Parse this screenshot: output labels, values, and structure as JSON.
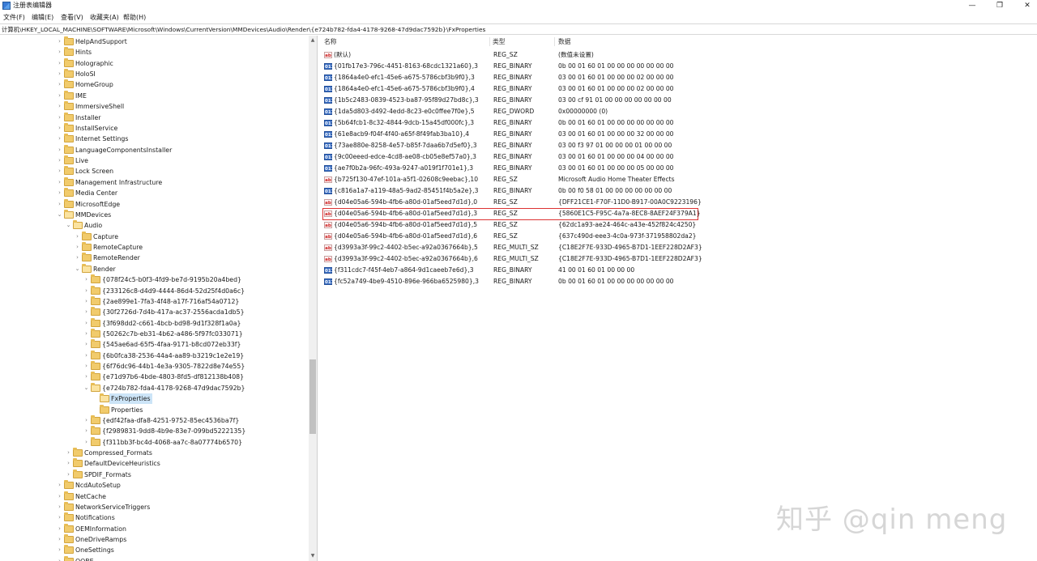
{
  "window": {
    "title": "注册表编辑器",
    "minimize_glyph": "—",
    "maximize_glyph": "❐",
    "close_glyph": "✕"
  },
  "menu": {
    "items": [
      "文件(F)",
      "编辑(E)",
      "查看(V)",
      "收藏夹(A)",
      "帮助(H)"
    ]
  },
  "address": {
    "path": "计算机\\HKEY_LOCAL_MACHINE\\SOFTWARE\\Microsoft\\Windows\\CurrentVersion\\MMDevices\\Audio\\Render\\{e724b782-fda4-4178-9268-47d9dac7592b}\\FxProperties"
  },
  "tree": {
    "items": [
      {
        "label": "HelpAndSupport",
        "level": 0,
        "arrow": "›"
      },
      {
        "label": "Hints",
        "level": 0,
        "arrow": "›"
      },
      {
        "label": "Holographic",
        "level": 0,
        "arrow": "›"
      },
      {
        "label": "HoloSI",
        "level": 0,
        "arrow": "›"
      },
      {
        "label": "HomeGroup",
        "level": 0,
        "arrow": "›"
      },
      {
        "label": "IME",
        "level": 0,
        "arrow": "›"
      },
      {
        "label": "ImmersiveShell",
        "level": 0,
        "arrow": "›"
      },
      {
        "label": "Installer",
        "level": 0,
        "arrow": "›"
      },
      {
        "label": "InstallService",
        "level": 0,
        "arrow": "›"
      },
      {
        "label": "Internet Settings",
        "level": 0,
        "arrow": "›"
      },
      {
        "label": "LanguageComponentsInstaller",
        "level": 0,
        "arrow": "›"
      },
      {
        "label": "Live",
        "level": 0,
        "arrow": "›"
      },
      {
        "label": "Lock Screen",
        "level": 0,
        "arrow": "›"
      },
      {
        "label": "Management Infrastructure",
        "level": 0,
        "arrow": "›"
      },
      {
        "label": "Media Center",
        "level": 0,
        "arrow": "›"
      },
      {
        "label": "MicrosoftEdge",
        "level": 0,
        "arrow": "›"
      },
      {
        "label": "MMDevices",
        "level": 0,
        "arrow": "⌄",
        "open": true
      },
      {
        "label": "Audio",
        "level": 1,
        "arrow": "⌄",
        "open": true
      },
      {
        "label": "Capture",
        "level": 2,
        "arrow": "›"
      },
      {
        "label": "RemoteCapture",
        "level": 2,
        "arrow": "›"
      },
      {
        "label": "RemoteRender",
        "level": 2,
        "arrow": "›"
      },
      {
        "label": "Render",
        "level": 2,
        "arrow": "⌄",
        "open": true
      },
      {
        "label": "{078f24c5-b0f3-4fd9-be7d-9195b20a4bed}",
        "level": 3,
        "arrow": "›"
      },
      {
        "label": "{233126c8-d4d9-4444-86d4-52d25f4d0a6c}",
        "level": 3,
        "arrow": "›"
      },
      {
        "label": "{2ae899e1-7fa3-4f48-a17f-716af54a0712}",
        "level": 3,
        "arrow": "›"
      },
      {
        "label": "{30f2726d-7d4b-417a-ac37-2556acda1db5}",
        "level": 3,
        "arrow": "›"
      },
      {
        "label": "{3f698dd2-c661-4bcb-bd98-9d1f328f1a0a}",
        "level": 3,
        "arrow": "›"
      },
      {
        "label": "{50262c7b-eb31-4b62-a486-5f97fc033071}",
        "level": 3,
        "arrow": "›"
      },
      {
        "label": "{545ae6ad-65f5-4faa-9171-b8cd072eb33f}",
        "level": 3,
        "arrow": "›"
      },
      {
        "label": "{6b0fca38-2536-44a4-aa89-b3219c1e2e19}",
        "level": 3,
        "arrow": "›"
      },
      {
        "label": "{6f76dc96-44b1-4e3a-9305-7822d8e74e55}",
        "level": 3,
        "arrow": "›"
      },
      {
        "label": "{e71d97b6-4bde-4803-8fd5-df812138b408}",
        "level": 3,
        "arrow": "›"
      },
      {
        "label": "{e724b782-fda4-4178-9268-47d9dac7592b}",
        "level": 3,
        "arrow": "⌄",
        "open": true
      },
      {
        "label": "FxProperties",
        "level": 4,
        "arrow": "",
        "selected": true,
        "open": true
      },
      {
        "label": "Properties",
        "level": 4,
        "arrow": ""
      },
      {
        "label": "{edf42faa-dfa8-4251-9752-85ec4536ba7f}",
        "level": 3,
        "arrow": "›"
      },
      {
        "label": "{f2989831-9dd8-4b9e-83e7-099bd5222135}",
        "level": 3,
        "arrow": "›"
      },
      {
        "label": "{f311bb3f-bc4d-4068-aa7c-8a07774b6570}",
        "level": 3,
        "arrow": "›"
      },
      {
        "label": "Compressed_Formats",
        "level": 1,
        "arrow": "›"
      },
      {
        "label": "DefaultDeviceHeuristics",
        "level": 1,
        "arrow": "›"
      },
      {
        "label": "SPDIF_Formats",
        "level": 1,
        "arrow": "›"
      },
      {
        "label": "NcdAutoSetup",
        "level": 0,
        "arrow": "›"
      },
      {
        "label": "NetCache",
        "level": 0,
        "arrow": "›"
      },
      {
        "label": "NetworkServiceTriggers",
        "level": 0,
        "arrow": "›"
      },
      {
        "label": "Notifications",
        "level": 0,
        "arrow": "›"
      },
      {
        "label": "OEMInformation",
        "level": 0,
        "arrow": "›"
      },
      {
        "label": "OneDriveRamps",
        "level": 0,
        "arrow": "›"
      },
      {
        "label": "OneSettings",
        "level": 0,
        "arrow": "›"
      },
      {
        "label": "OOBE",
        "level": 0,
        "arrow": "›"
      }
    ]
  },
  "values": {
    "headers": {
      "name": "名称",
      "type": "类型",
      "data": "数据"
    },
    "rows": [
      {
        "icon": "ab",
        "name": "(默认)",
        "type": "REG_SZ",
        "data": "(数值未设置)"
      },
      {
        "icon": "bin",
        "name": "{01fb17e3-796c-4451-8163-68cdc1321a60},3",
        "type": "REG_BINARY",
        "data": "0b 00 01 60 01 00 00 00 00 00 00 00"
      },
      {
        "icon": "bin",
        "name": "{1864a4e0-efc1-45e6-a675-5786cbf3b9f0},3",
        "type": "REG_BINARY",
        "data": "03 00 01 60 01 00 00 00 02 00 00 00"
      },
      {
        "icon": "bin",
        "name": "{1864a4e0-efc1-45e6-a675-5786cbf3b9f0},4",
        "type": "REG_BINARY",
        "data": "03 00 01 60 01 00 00 00 02 00 00 00"
      },
      {
        "icon": "bin",
        "name": "{1b5c2483-0839-4523-ba87-95f89d27bd8c},3",
        "type": "REG_BINARY",
        "data": "03 00 cf 91 01 00 00 00 00 00 00 00"
      },
      {
        "icon": "bin",
        "name": "{1da5d803-d492-4edd-8c23-e0c0ffee7f0e},5",
        "type": "REG_DWORD",
        "data": "0x00000000 (0)"
      },
      {
        "icon": "bin",
        "name": "{5b64fcb1-8c32-4844-9dcb-15a45df000fc},3",
        "type": "REG_BINARY",
        "data": "0b 00 01 60 01 00 00 00 00 00 00 00"
      },
      {
        "icon": "bin",
        "name": "{61e8acb9-f04f-4f40-a65f-8f49fab3ba10},4",
        "type": "REG_BINARY",
        "data": "03 00 01 60 01 00 00 00 32 00 00 00"
      },
      {
        "icon": "bin",
        "name": "{73ae880e-8258-4e57-b85f-7daa6b7d5ef0},3",
        "type": "REG_BINARY",
        "data": "03 00 f3 97 01 00 00 00 01 00 00 00"
      },
      {
        "icon": "bin",
        "name": "{9c00eeed-edce-4cd8-ae08-cb05e8ef57a0},3",
        "type": "REG_BINARY",
        "data": "03 00 01 60 01 00 00 00 04 00 00 00"
      },
      {
        "icon": "bin",
        "name": "{ae7f0b2a-96fc-493a-9247-a019f1f701e1},3",
        "type": "REG_BINARY",
        "data": "03 00 01 60 01 00 00 00 05 00 00 00"
      },
      {
        "icon": "ab",
        "name": "{b725f130-47ef-101a-a5f1-02608c9eebac},10",
        "type": "REG_SZ",
        "data": "Microsoft Audio Home Theater Effects"
      },
      {
        "icon": "bin",
        "name": "{c816a1a7-a119-48a5-9ad2-85451f4b5a2e},3",
        "type": "REG_BINARY",
        "data": "0b 00 f0 58 01 00 00 00 00 00 00 00"
      },
      {
        "icon": "ab",
        "name": "{d04e05a6-594b-4fb6-a80d-01af5eed7d1d},0",
        "type": "REG_SZ",
        "data": "{DFF21CE1-F70F-11D0-B917-00A0C9223196}"
      },
      {
        "icon": "ab",
        "name": "{d04e05a6-594b-4fb6-a80d-01af5eed7d1d},3",
        "type": "REG_SZ",
        "data": "{5860E1C5-F95C-4a7a-8EC8-8AEF24F379A1}",
        "highlighted": true
      },
      {
        "icon": "ab",
        "name": "{d04e05a6-594b-4fb6-a80d-01af5eed7d1d},5",
        "type": "REG_SZ",
        "data": "{62dc1a93-ae24-464c-a43e-452f824c4250}"
      },
      {
        "icon": "ab",
        "name": "{d04e05a6-594b-4fb6-a80d-01af5eed7d1d},6",
        "type": "REG_SZ",
        "data": "{637c490d-eee3-4c0a-973f-371958802da2}"
      },
      {
        "icon": "ab",
        "name": "{d3993a3f-99c2-4402-b5ec-a92a0367664b},5",
        "type": "REG_MULTI_SZ",
        "data": "{C18E2F7E-933D-4965-B7D1-1EEF228D2AF3}"
      },
      {
        "icon": "ab",
        "name": "{d3993a3f-99c2-4402-b5ec-a92a0367664b},6",
        "type": "REG_MULTI_SZ",
        "data": "{C18E2F7E-933D-4965-B7D1-1EEF228D2AF3}"
      },
      {
        "icon": "bin",
        "name": "{f311cdc7-f45f-4eb7-a864-9d1caeeb7e6d},3",
        "type": "REG_BINARY",
        "data": "41 00 01 60 01 00 00 00"
      },
      {
        "icon": "bin",
        "name": "{fc52a749-4be9-4510-896e-966ba6525980},3",
        "type": "REG_BINARY",
        "data": "0b 00 01 60 01 00 00 00 00 00 00 00"
      }
    ]
  },
  "watermark": {
    "text": "知乎 @qin meng"
  },
  "scrollbar": {
    "up_glyph": "▲",
    "down_glyph": "▼"
  },
  "icon_glyphs": {
    "ab": "ab",
    "bin": "011"
  }
}
